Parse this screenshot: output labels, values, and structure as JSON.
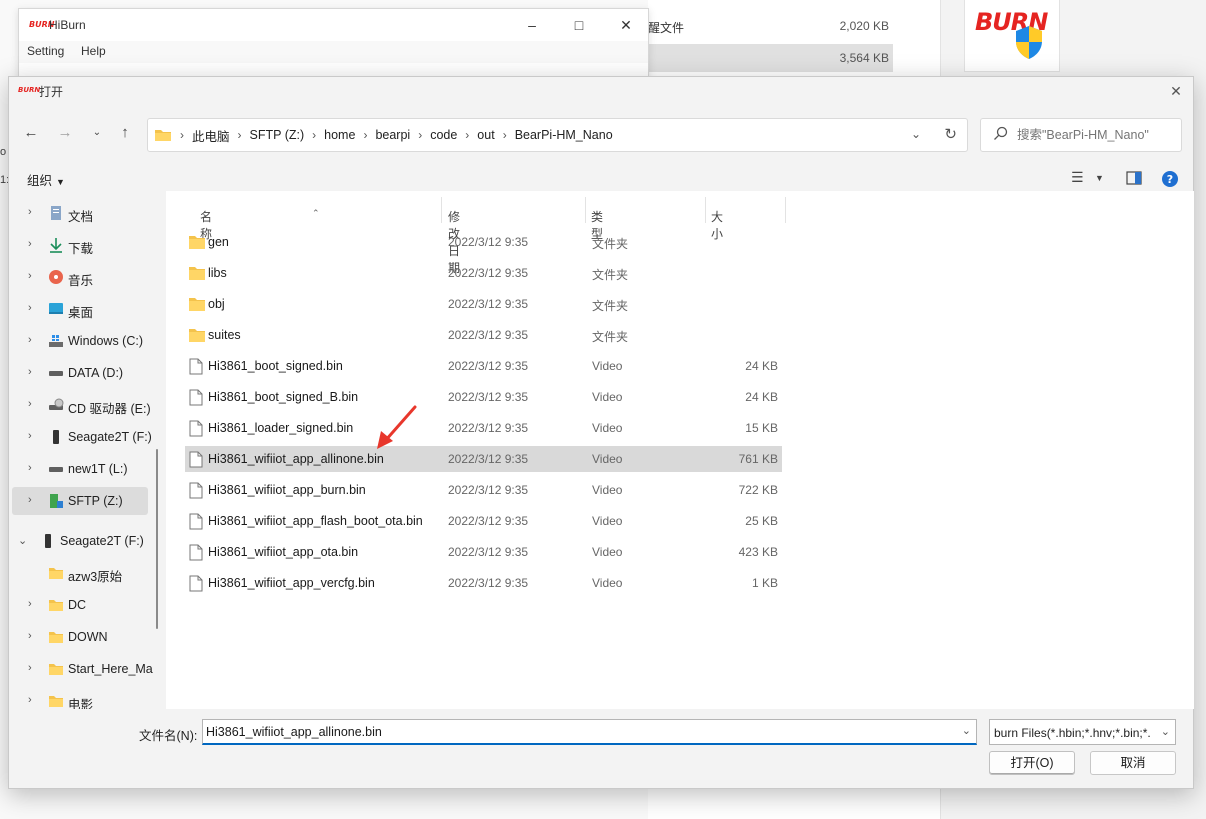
{
  "background": {
    "rows": [
      {
        "name": "醒文件",
        "size": "2,020 KB",
        "selected": false
      },
      {
        "name": "",
        "size": "3,564 KB",
        "selected": true
      }
    ],
    "burn_logo_text": "BURN",
    "edge_fragments": [
      "o",
      "1:"
    ]
  },
  "hiburn": {
    "logo": "BURN",
    "title": "HiBurn",
    "menu": [
      "Setting",
      "Help"
    ]
  },
  "dialog": {
    "logo": "BURN",
    "title": "打开",
    "breadcrumb": [
      "此电脑",
      "SFTP (Z:)",
      "home",
      "bearpi",
      "code",
      "out",
      "BearPi-HM_Nano"
    ],
    "search_placeholder": "搜索\"BearPi-HM_Nano\"",
    "organize_label": "组织",
    "nav_items": [
      {
        "label": "文档",
        "icon": "documents-icon",
        "expandable": true,
        "selected": false
      },
      {
        "label": "下载",
        "icon": "download-icon",
        "expandable": true,
        "selected": false
      },
      {
        "label": "音乐",
        "icon": "music-icon",
        "expandable": true,
        "selected": false
      },
      {
        "label": "桌面",
        "icon": "desktop-icon",
        "expandable": true,
        "selected": false
      },
      {
        "label": "Windows (C:)",
        "icon": "windows-drive-icon",
        "expandable": true,
        "selected": false
      },
      {
        "label": "DATA (D:)",
        "icon": "drive-icon",
        "expandable": true,
        "selected": false
      },
      {
        "label": "CD 驱动器 (E:)",
        "icon": "cd-drive-icon",
        "expandable": true,
        "selected": false
      },
      {
        "label": "Seagate2T (F:)",
        "icon": "usb-drive-icon",
        "expandable": true,
        "selected": false
      },
      {
        "label": "new1T (L:)",
        "icon": "drive-icon",
        "expandable": true,
        "selected": false
      },
      {
        "label": "SFTP (Z:)",
        "icon": "network-drive-icon",
        "expandable": true,
        "selected": true
      },
      {
        "label": "Seagate2T (F:)",
        "icon": "usb-drive-icon",
        "expandable": true,
        "expanded": true,
        "selected": false
      },
      {
        "label": "azw3原始",
        "icon": "folder-icon",
        "expandable": false,
        "selected": false
      },
      {
        "label": "DC",
        "icon": "folder-icon",
        "expandable": true,
        "selected": false
      },
      {
        "label": "DOWN",
        "icon": "folder-icon",
        "expandable": true,
        "selected": false
      },
      {
        "label": "Start_Here_Ma",
        "icon": "folder-icon",
        "expandable": true,
        "selected": false
      },
      {
        "label": "电影",
        "icon": "folder-icon",
        "expandable": true,
        "selected": false
      }
    ],
    "columns": {
      "name": "名称",
      "date": "修改日期",
      "type": "类型",
      "size": "大小"
    },
    "files": [
      {
        "name": "gen",
        "date": "2022/3/12 9:35",
        "type": "文件夹",
        "size": "",
        "kind": "folder"
      },
      {
        "name": "libs",
        "date": "2022/3/12 9:35",
        "type": "文件夹",
        "size": "",
        "kind": "folder"
      },
      {
        "name": "obj",
        "date": "2022/3/12 9:35",
        "type": "文件夹",
        "size": "",
        "kind": "folder"
      },
      {
        "name": "suites",
        "date": "2022/3/12 9:35",
        "type": "文件夹",
        "size": "",
        "kind": "folder"
      },
      {
        "name": "Hi3861_boot_signed.bin",
        "date": "2022/3/12 9:35",
        "type": "Video",
        "size": "24 KB",
        "kind": "file"
      },
      {
        "name": "Hi3861_boot_signed_B.bin",
        "date": "2022/3/12 9:35",
        "type": "Video",
        "size": "24 KB",
        "kind": "file"
      },
      {
        "name": "Hi3861_loader_signed.bin",
        "date": "2022/3/12 9:35",
        "type": "Video",
        "size": "15 KB",
        "kind": "file"
      },
      {
        "name": "Hi3861_wifiiot_app_allinone.bin",
        "date": "2022/3/12 9:35",
        "type": "Video",
        "size": "761 KB",
        "kind": "file",
        "selected": true
      },
      {
        "name": "Hi3861_wifiiot_app_burn.bin",
        "date": "2022/3/12 9:35",
        "type": "Video",
        "size": "722 KB",
        "kind": "file"
      },
      {
        "name": "Hi3861_wifiiot_app_flash_boot_ota.bin",
        "date": "2022/3/12 9:35",
        "type": "Video",
        "size": "25 KB",
        "kind": "file"
      },
      {
        "name": "Hi3861_wifiiot_app_ota.bin",
        "date": "2022/3/12 9:35",
        "type": "Video",
        "size": "423 KB",
        "kind": "file"
      },
      {
        "name": "Hi3861_wifiiot_app_vercfg.bin",
        "date": "2022/3/12 9:35",
        "type": "Video",
        "size": "1 KB",
        "kind": "file"
      }
    ],
    "filename_label": "文件名(N):",
    "filename_value": "Hi3861_wifiiot_app_allinone.bin",
    "filter_value": "burn Files(*.hbin;*.hnv;*.bin;*.",
    "open_button": "打开(O)",
    "cancel_button": "取消",
    "colors": {
      "accent": "#0067c0",
      "selection": "#d9d9d9",
      "folder": "#f4c34c",
      "annotation_arrow": "#e8372c",
      "burn_red": "#e52421"
    }
  }
}
